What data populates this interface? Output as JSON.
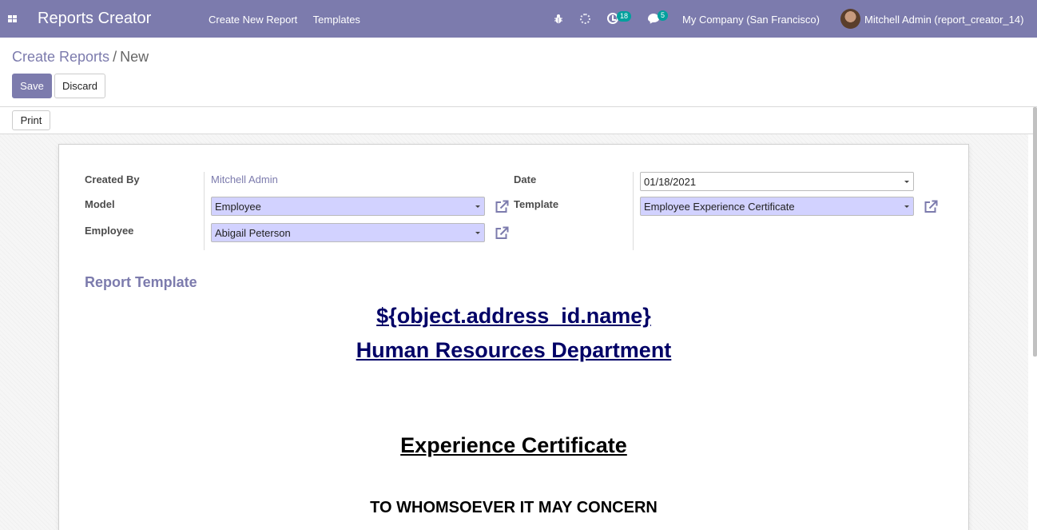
{
  "app": {
    "title": "Reports Creator",
    "menu": [
      "Create New Report",
      "Templates"
    ]
  },
  "systray": {
    "activity_count": "18",
    "message_count": "5",
    "company": "My Company (San Francisco)",
    "user": "Mitchell Admin (report_creator_14)"
  },
  "breadcrumb": {
    "parent": "Create Reports",
    "separator": "/",
    "current": "New"
  },
  "buttons": {
    "save": "Save",
    "discard": "Discard",
    "print": "Print"
  },
  "form": {
    "created_by_label": "Created By",
    "created_by_value": "Mitchell Admin",
    "model_label": "Model",
    "model_value": "Employee",
    "employee_label": "Employee",
    "employee_value": "Abigail Peterson",
    "date_label": "Date",
    "date_value": "01/18/2021",
    "template_label": "Template",
    "template_value": "Employee Experience Certificate"
  },
  "report_template": {
    "title": "Report Template",
    "line1": "${object.address_id.name}",
    "line2": "Human Resources Department",
    "heading": "Experience Certificate",
    "salutation": "TO WHOMSOEVER IT MAY CONCERN"
  },
  "colors": {
    "navbar": "#7c7bad",
    "primary": "#7c7bad",
    "required_field": "#d2d2ff",
    "badge": "#00a09d",
    "doc_heading": "#000066"
  }
}
